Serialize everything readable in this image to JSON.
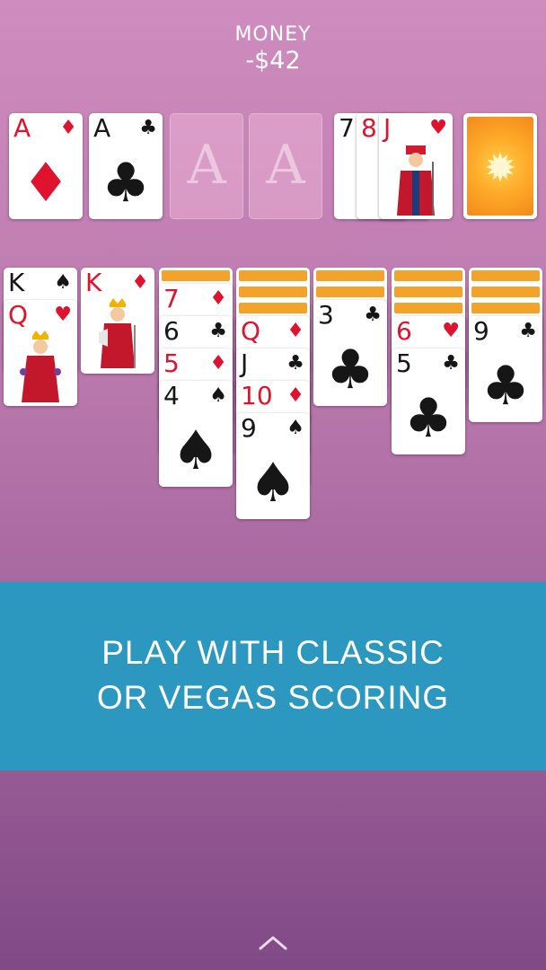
{
  "hud": {
    "label": "MONEY",
    "value": "-$42"
  },
  "foundations": [
    {
      "rank": "A",
      "suit": "♦",
      "color": "red"
    },
    {
      "rank": "A",
      "suit": "♣",
      "color": "black"
    },
    {
      "placeholder": "A"
    },
    {
      "placeholder": "A"
    }
  ],
  "waste": [
    {
      "rank": "7"
    },
    {
      "rank": "8"
    },
    {
      "rank": "J",
      "suit": "♥"
    }
  ],
  "stock": {
    "icon": "sun-icon"
  },
  "tableau": {
    "col1": [
      {
        "rank": "K",
        "suit": "♠"
      },
      {
        "rank": "Q",
        "suit": "♥"
      }
    ],
    "col2": [
      {
        "rank": "K",
        "suit": "♦"
      }
    ],
    "col3": [
      {
        "rank": "7",
        "suit": "♦"
      },
      {
        "rank": "6",
        "suit": "♣"
      },
      {
        "rank": "5",
        "suit": "♦"
      },
      {
        "rank": "4",
        "suit": "♠"
      }
    ],
    "col4": [
      {
        "rank": "Q",
        "suit": "♦"
      },
      {
        "rank": "J",
        "suit": "♣"
      },
      {
        "rank": "10",
        "suit": "♦"
      },
      {
        "rank": "9",
        "suit": "♠"
      }
    ],
    "col5": [
      {
        "rank": "3",
        "suit": "♣"
      }
    ],
    "col6": [
      {
        "rank": "6",
        "suit": "♥"
      },
      {
        "rank": "5",
        "suit": "♣"
      }
    ],
    "col7": [
      {
        "rank": "9",
        "suit": "♣"
      }
    ]
  },
  "banner": {
    "line1": "PLAY WITH CLASSIC",
    "line2": "OR VEGAS SCORING"
  },
  "colors": {
    "accent": "#2c97bf",
    "red_suit": "#e0132f",
    "card_back": "#f3a22a"
  }
}
